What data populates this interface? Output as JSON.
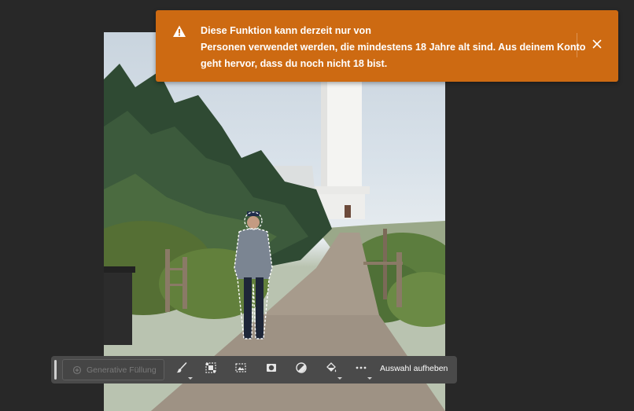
{
  "notification": {
    "type": "warning",
    "color": "#cd6a12",
    "icon": "warning-icon",
    "lines": [
      "Diese Funktion kann derzeit nur von",
      "Personen verwendet werden, die mindestens 18 Jahre alt sind. Aus deinem Konto",
      "geht hervor, dass du noch nicht 18 bist."
    ],
    "close_icon": "close-icon"
  },
  "canvas": {
    "image_description_icon": "photo"
  },
  "taskbar": {
    "generative_fill_placeholder": "Generative Füllung",
    "tools": [
      {
        "icon": "brush-icon",
        "has_menu": true
      },
      {
        "icon": "select-subject-icon",
        "has_menu": false
      },
      {
        "icon": "transform-selection-icon",
        "has_menu": false
      },
      {
        "icon": "mask-icon",
        "has_menu": false
      },
      {
        "icon": "adjustment-icon",
        "has_menu": false
      },
      {
        "icon": "fill-bucket-icon",
        "has_menu": true
      },
      {
        "icon": "more-icon",
        "has_menu": true
      }
    ],
    "deselect_label": "Auswahl aufheben"
  }
}
